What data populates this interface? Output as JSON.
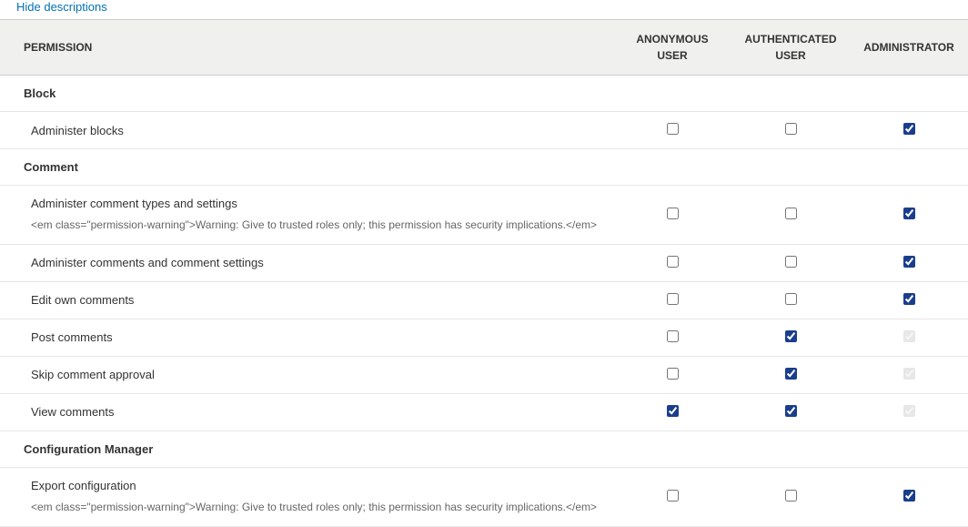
{
  "hide_descriptions_label": "Hide descriptions",
  "headers": {
    "permission": "PERMISSION",
    "roles": [
      "ANONYMOUS USER",
      "AUTHENTICATED USER",
      "ADMINISTRATOR"
    ]
  },
  "groups": [
    {
      "name": "Block",
      "permissions": [
        {
          "label": "Administer blocks",
          "description": "",
          "checks": [
            {
              "checked": false,
              "disabled": false
            },
            {
              "checked": false,
              "disabled": false
            },
            {
              "checked": true,
              "disabled": false
            }
          ]
        }
      ]
    },
    {
      "name": "Comment",
      "permissions": [
        {
          "label": "Administer comment types and settings",
          "description": "<em class=\"permission-warning\">Warning: Give to trusted roles only; this permission has security implications.</em>",
          "checks": [
            {
              "checked": false,
              "disabled": false
            },
            {
              "checked": false,
              "disabled": false
            },
            {
              "checked": true,
              "disabled": false
            }
          ]
        },
        {
          "label": "Administer comments and comment settings",
          "description": "",
          "checks": [
            {
              "checked": false,
              "disabled": false
            },
            {
              "checked": false,
              "disabled": false
            },
            {
              "checked": true,
              "disabled": false
            }
          ]
        },
        {
          "label": "Edit own comments",
          "description": "",
          "checks": [
            {
              "checked": false,
              "disabled": false
            },
            {
              "checked": false,
              "disabled": false
            },
            {
              "checked": true,
              "disabled": false
            }
          ]
        },
        {
          "label": "Post comments",
          "description": "",
          "checks": [
            {
              "checked": false,
              "disabled": false
            },
            {
              "checked": true,
              "disabled": false
            },
            {
              "checked": true,
              "disabled": true
            }
          ]
        },
        {
          "label": "Skip comment approval",
          "description": "",
          "checks": [
            {
              "checked": false,
              "disabled": false
            },
            {
              "checked": true,
              "disabled": false
            },
            {
              "checked": true,
              "disabled": true
            }
          ]
        },
        {
          "label": "View comments",
          "description": "",
          "checks": [
            {
              "checked": true,
              "disabled": false
            },
            {
              "checked": true,
              "disabled": false
            },
            {
              "checked": true,
              "disabled": true
            }
          ]
        }
      ]
    },
    {
      "name": "Configuration Manager",
      "permissions": [
        {
          "label": "Export configuration",
          "description": "<em class=\"permission-warning\">Warning: Give to trusted roles only; this permission has security implications.</em>",
          "checks": [
            {
              "checked": false,
              "disabled": false
            },
            {
              "checked": false,
              "disabled": false
            },
            {
              "checked": true,
              "disabled": false
            }
          ]
        }
      ]
    }
  ]
}
